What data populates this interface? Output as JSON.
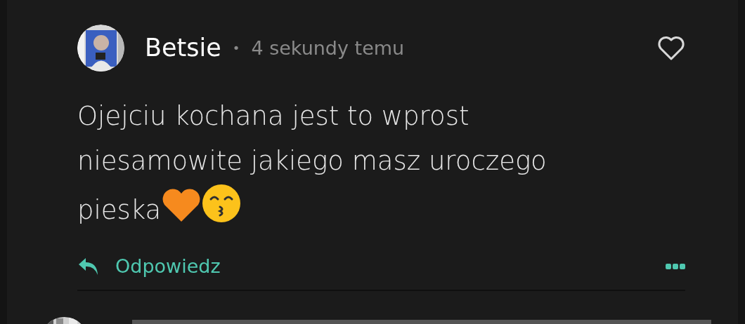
{
  "comment": {
    "author": "Betsie",
    "separator": "•",
    "time": "4 sekundy temu",
    "liked": false,
    "text": "Ojejciu kochana jest to wprost niesamowite jakiego masz uroczego pieska",
    "reply_label": "Odpowiedz"
  }
}
